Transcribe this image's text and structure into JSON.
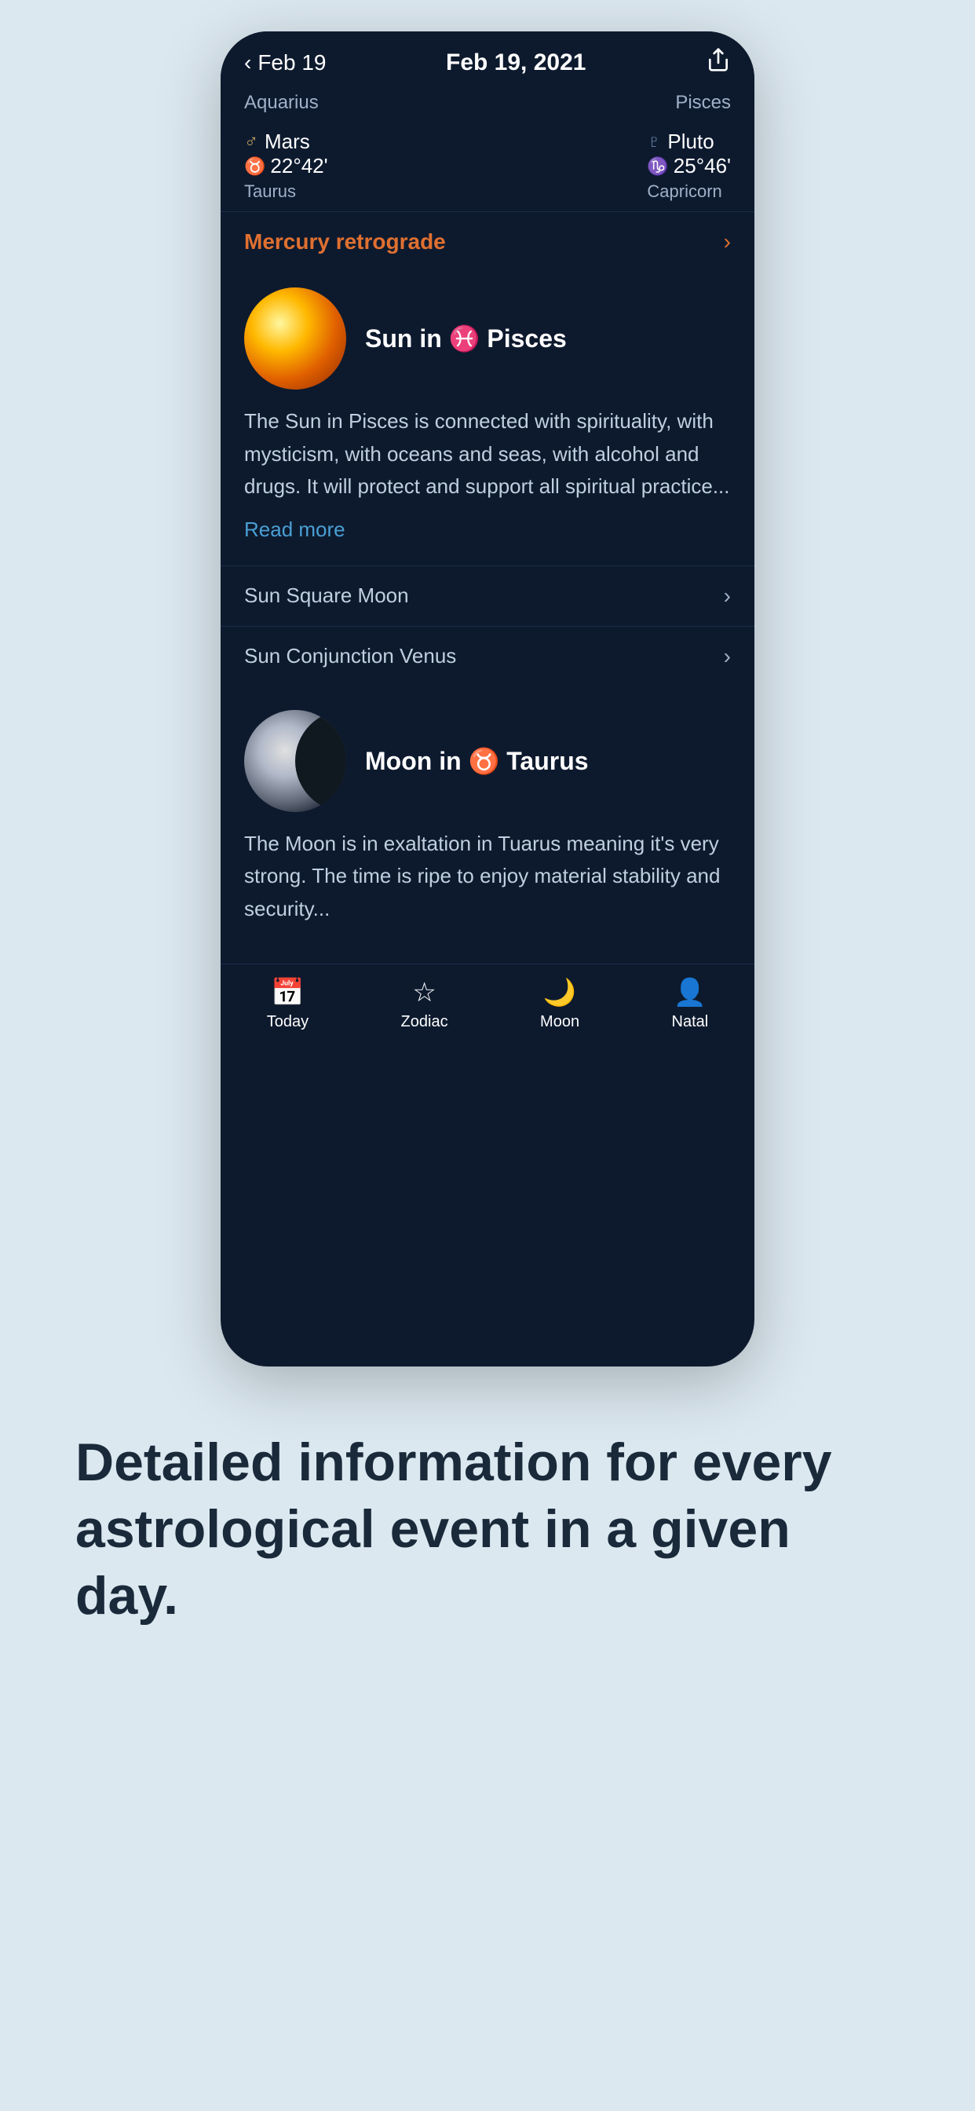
{
  "header": {
    "back_label": "Feb 19",
    "date": "Feb 19, 2021",
    "share_icon": "share"
  },
  "zodiac_row": {
    "left": "Aquarius",
    "right": "Pisces"
  },
  "planets": [
    {
      "symbol": "♂",
      "name": "Mars",
      "degree_symbol": "♉",
      "degree": "22°42'",
      "sign": "Taurus"
    },
    {
      "symbol": "♇",
      "name": "Pluto",
      "degree_symbol": "♑",
      "degree": "25°46'",
      "sign": "Capricorn"
    }
  ],
  "mercury_retrograde": {
    "label": "Mercury retrograde"
  },
  "sun_section": {
    "title": "Sun in ♓ Pisces",
    "body": "The Sun in Pisces is connected with spirituality, with mysticism, with oceans and seas, with alcohol and drugs. It will protect and support all spiritual practice...",
    "read_more": "Read more"
  },
  "aspects": [
    {
      "label": "Sun Square Moon"
    },
    {
      "label": "Sun Conjunction Venus"
    }
  ],
  "moon_section": {
    "title": "Moon in ♉ Taurus",
    "body": "The Moon is in exaltation in Tuarus meaning it's very strong. The time is ripe to enjoy material stability and security..."
  },
  "tabs": [
    {
      "label": "Today",
      "icon": "📅"
    },
    {
      "label": "Zodiac",
      "icon": "⭐"
    },
    {
      "label": "Moon",
      "icon": "🌙"
    },
    {
      "label": "Natal",
      "icon": "👤"
    }
  ],
  "description": {
    "text": "Detailed information for every astrological event in a given day."
  },
  "colors": {
    "accent_orange": "#e07030",
    "accent_blue": "#4a9fd4",
    "background_dark": "#0d1a2e",
    "text_white": "#ffffff",
    "text_muted": "#a0b0c8"
  }
}
